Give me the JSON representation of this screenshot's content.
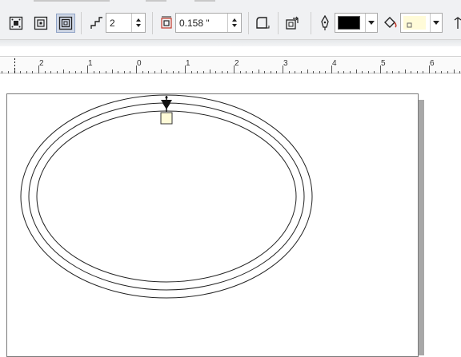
{
  "toolbar": {
    "contour_direction": {
      "center_icon": "contour-to-center-icon",
      "inside_icon": "contour-inside-icon",
      "outside_icon": "contour-outside-icon",
      "active": "outside"
    },
    "steps_icon": "contour-steps-icon",
    "steps_value": "2",
    "offset_icon": "contour-offset-icon",
    "offset_value": "0.158 \"",
    "corners_icon": "contour-corners-icon",
    "color_accel_icon": "contour-color-acceleration-icon",
    "outline_icon": "outline-pen-icon",
    "outline_color": "#000000",
    "fill_icon": "fill-bucket-icon",
    "fill_color": "#fffbd8"
  },
  "ruler": {
    "labels": [
      "2",
      "1",
      "0",
      "1",
      "2",
      "3",
      "4",
      "5",
      "6"
    ]
  },
  "canvas": {
    "object": "contour-ellipse",
    "contour_steps": 2,
    "handle_color": "#fffbd8",
    "marker_icon": "contour-direction-marker-icon"
  }
}
